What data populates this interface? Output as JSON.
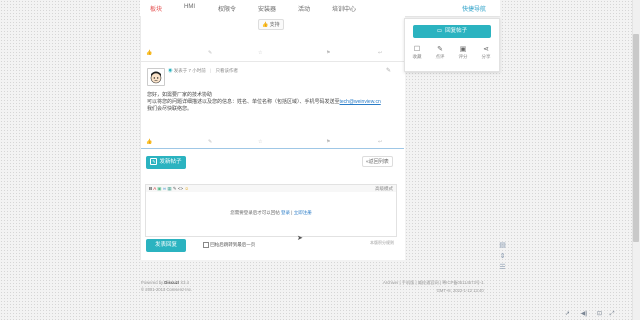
{
  "nav": {
    "tabs": [
      "板块",
      "HMI",
      "权限令",
      "安装器",
      "活动",
      "培训中心"
    ],
    "right_link": "快捷导航"
  },
  "post1": {
    "support_button": "👍 支持",
    "meta": [
      "",
      "",
      "",
      ""
    ]
  },
  "post2": {
    "time": "发表于 7 小时前",
    "author_only": "只看该作者",
    "line1": "您好，如需要厂家的技术协助",
    "line2_prefix": "可以将您的问题详细描述以及您的信息：姓名、单位名称（包括区域）、手机号码发送至",
    "email": "tech@weinview.cn",
    "line3": "我们会尽快联络您。"
  },
  "new_post": {
    "button": "发新帖子",
    "back": "«返回列表"
  },
  "editor": {
    "mode": "高级模式",
    "login_prefix": "您需要登录后才可以回帖",
    "login": "登录",
    "sep": "|",
    "register": "立即注册",
    "reply_button": "发表回复",
    "return_checkbox": "回帖后跳转到最后一页",
    "reward": "本版积分规则"
  },
  "float_panel": {
    "reply_button": "回复帖子",
    "items": [
      {
        "label": "收藏",
        "icon": "star-icon"
      },
      {
        "label": "点评",
        "icon": "pencil-icon"
      },
      {
        "label": "评分",
        "icon": "save-icon"
      },
      {
        "label": "分享",
        "icon": "share-icon"
      }
    ]
  },
  "footer": {
    "powered_prefix": "Powered by",
    "powered_brand": "Discuz!",
    "powered_version": "X3.4",
    "copyright": "© 2001-2013 Comsenz Inc.",
    "right_line1": "Archiver | 手机版 | 威纶通官网 | 粤ICP备05114573号-1",
    "right_line2": "GMT+8, 2022-1-12 13:40"
  },
  "colors": {
    "teal": "#2bb3c0",
    "red_accent": "#e44d4d",
    "link_blue": "#2a7cc7"
  }
}
